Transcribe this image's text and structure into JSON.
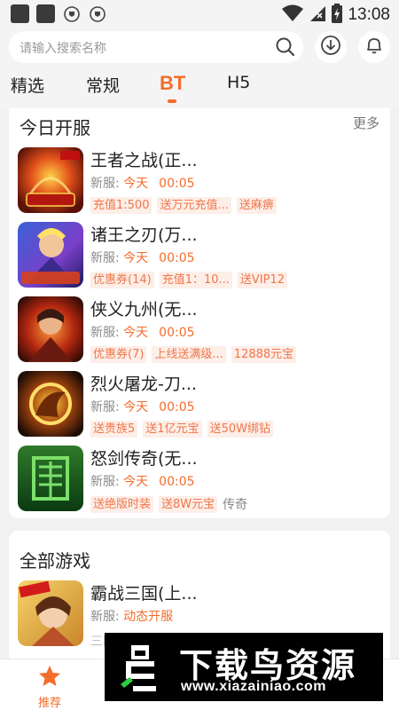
{
  "status_bar": {
    "time": "13:08"
  },
  "search": {
    "placeholder": "请输入搜索名称"
  },
  "tabs": [
    {
      "label": "精选"
    },
    {
      "label": "常规"
    },
    {
      "label": "BT",
      "active": true
    },
    {
      "label": "H5"
    }
  ],
  "today": {
    "title": "今日开服",
    "more": "更多",
    "games": [
      {
        "name": "王者之战(正...",
        "server_label": "新服:",
        "day": "今天",
        "time": "00:05",
        "tags": [
          "充值1:500",
          "送万元充值...",
          "送麻痹"
        ],
        "icon": "game-icon-wangzhe"
      },
      {
        "name": "诸王之刃(万...",
        "server_label": "新服:",
        "day": "今天",
        "time": "00:05",
        "tags": [
          "优惠券(14)",
          "充值1：10...",
          "送VIP12"
        ],
        "icon": "game-icon-zhuwang"
      },
      {
        "name": "侠义九州(无...",
        "server_label": "新服:",
        "day": "今天",
        "time": "00:05",
        "tags": [
          "优惠券(7)",
          "上线送满级...",
          "12888元宝"
        ],
        "icon": "game-icon-xiayi"
      },
      {
        "name": "烈火屠龙-刀...",
        "server_label": "新服:",
        "day": "今天",
        "time": "00:05",
        "tags": [
          "送贵族5",
          "送1亿元宝",
          "送50W绑钻"
        ],
        "icon": "game-icon-liehuo"
      },
      {
        "name": "怒剑传奇(无...",
        "server_label": "新服:",
        "day": "今天",
        "time": "00:05",
        "tags": [
          "送绝版时装",
          "送8W元宝"
        ],
        "genre": "传奇",
        "icon": "game-icon-nujian"
      }
    ]
  },
  "all_games": {
    "title": "全部游戏",
    "games": [
      {
        "name": "霸战三国(上...",
        "server_label": "新服:",
        "status": "动态开服",
        "genre_partial": "三国 卡牌 策略",
        "icon": "game-icon-bazhan"
      }
    ]
  },
  "bottom_nav": [
    {
      "label": "推荐",
      "active": true
    }
  ],
  "watermark": {
    "title": "下载鸟资源",
    "url": "www.xiazainiao.com"
  },
  "colors": {
    "accent": "#f36d2c",
    "tag_bg": "#fdeee8",
    "tag_text": "#f0764a"
  }
}
